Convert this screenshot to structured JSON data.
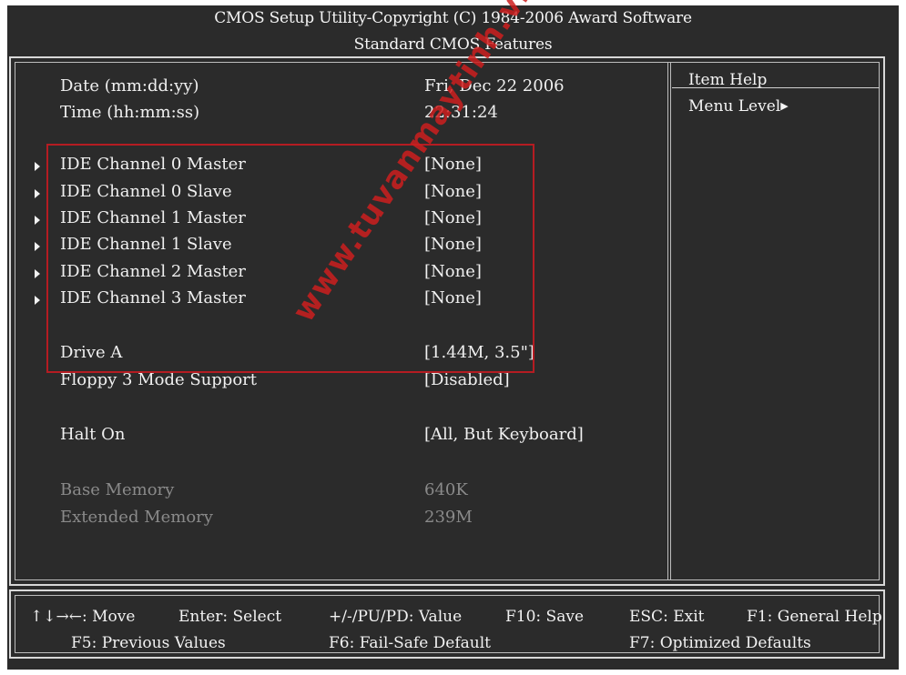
{
  "header": {
    "title": "CMOS Setup Utility-Copyright (C) 1984-2006 Award Software",
    "subtitle": "Standard CMOS Features"
  },
  "settings": [
    {
      "label": "Date (mm:dd:yy)",
      "value": "Fri, Dec  22  2006"
    },
    {
      "label": "Time (hh:mm:ss)",
      "value": "22:31:24"
    },
    {
      "label": "IDE Channel 0 Master",
      "value": "[None]"
    },
    {
      "label": "IDE Channel 0 Slave",
      "value": "[None]"
    },
    {
      "label": "IDE Channel 1 Master",
      "value": "[None]"
    },
    {
      "label": "IDE Channel 1 Slave",
      "value": "[None]"
    },
    {
      "label": "IDE Channel 2 Master",
      "value": "[None]"
    },
    {
      "label": "IDE Channel 3 Master",
      "value": "[None]"
    },
    {
      "label": "Drive A",
      "value": "[1.44M, 3.5\"]"
    },
    {
      "label": "Floppy 3 Mode Support",
      "value": "[Disabled]"
    },
    {
      "label": "Halt On",
      "value": "[All, But Keyboard]"
    },
    {
      "label": "Base Memory",
      "value": "640K"
    },
    {
      "label": "Extended Memory",
      "value": "239M"
    }
  ],
  "help": {
    "title": "Item Help",
    "menu_level": "Menu Level"
  },
  "watermark": "www.tuvanmaytinh.vn",
  "footer": {
    "move": "↑↓→←: Move",
    "enter": "Enter: Select",
    "value": "+/-/PU/PD: Value",
    "save": "F10: Save",
    "exit": "ESC: Exit",
    "help": "F1: General Help",
    "prev": "F5: Previous Values",
    "failsafe": "F6: Fail-Safe Default",
    "optimized": "F7: Optimized Defaults"
  },
  "colors": {
    "background": "#2b2b2b",
    "text": "#f0f0f0",
    "dim_text": "#8a8a8a",
    "highlight_box": "#b51c22",
    "watermark": "#cd1e1e"
  }
}
